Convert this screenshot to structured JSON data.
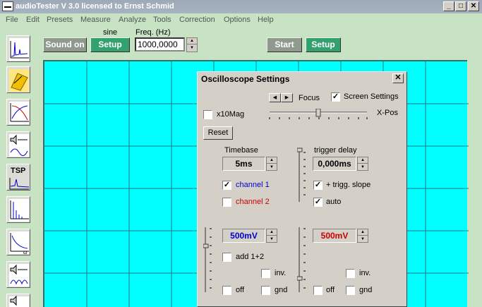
{
  "window": {
    "title": "audioTester  V 3.0   licensed to Ernst Schmid",
    "min": "_",
    "max": "□",
    "close": "✕"
  },
  "menu": [
    "File",
    "Edit",
    "Presets",
    "Measure",
    "Analyze",
    "Tools",
    "Correction",
    "Options",
    "Help"
  ],
  "toolbar": {
    "sound_on": "Sound on",
    "setup1": "Setup",
    "waveform": "sine",
    "freq_label": "Freq. (Hz)",
    "freq_value": "1000,0000",
    "start": "Start",
    "setup2": "Setup"
  },
  "sidebar": {
    "tsp_label": "TSP"
  },
  "colors": {
    "scope_bg": "#00ffff",
    "channel1": "#0000cc",
    "channel2": "#cc0000",
    "toolbar_green": "#33a070"
  },
  "dialog": {
    "title": "Oscilloscope Settings",
    "close": "✕",
    "focus_label": "Focus",
    "screen_settings": "Screen Settings",
    "screen_settings_checked": true,
    "x10mag": "x10Mag",
    "x10mag_checked": false,
    "xpos_label": "X-Pos",
    "reset": "Reset",
    "timebase_label": "Timebase",
    "timebase_value": "5ms",
    "trigger_delay_label": "trigger delay",
    "trigger_delay_value": "0,000ms",
    "channel1": "channel 1",
    "channel1_checked": true,
    "channel2": "channel 2",
    "channel2_checked": false,
    "trigg_slope": "+ trigg. slope",
    "trigg_slope_checked": true,
    "auto": "auto",
    "auto_checked": true,
    "ch1_volts": "500mV",
    "ch2_volts": "500mV",
    "add12": "add 1+2",
    "add12_checked": false,
    "inv": "inv.",
    "off": "off",
    "gnd": "gnd"
  }
}
